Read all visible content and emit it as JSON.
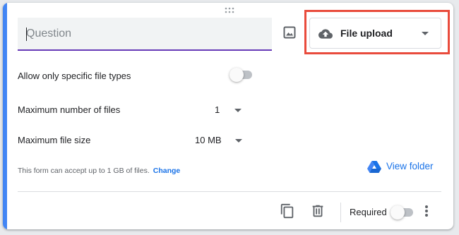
{
  "question": {
    "placeholder": "Question",
    "value": ""
  },
  "question_type": {
    "selected": "File upload",
    "icon": "cloud-upload-icon"
  },
  "settings": {
    "specific_types_label": "Allow only specific file types",
    "specific_types_enabled": false,
    "max_files_label": "Maximum number of files",
    "max_files_value": "1",
    "max_size_label": "Maximum file size",
    "max_size_value": "10 MB"
  },
  "capacity": {
    "text": "This form can accept up to 1 GB of files.",
    "change_label": "Change"
  },
  "view_folder": {
    "label": "View folder",
    "icon": "google-drive-icon"
  },
  "footer": {
    "required_label": "Required",
    "required_enabled": false
  },
  "colors": {
    "accent": "#4285f4",
    "focus_underline": "#673ab7",
    "link": "#1a73e8",
    "highlight": "#e94b3c"
  }
}
